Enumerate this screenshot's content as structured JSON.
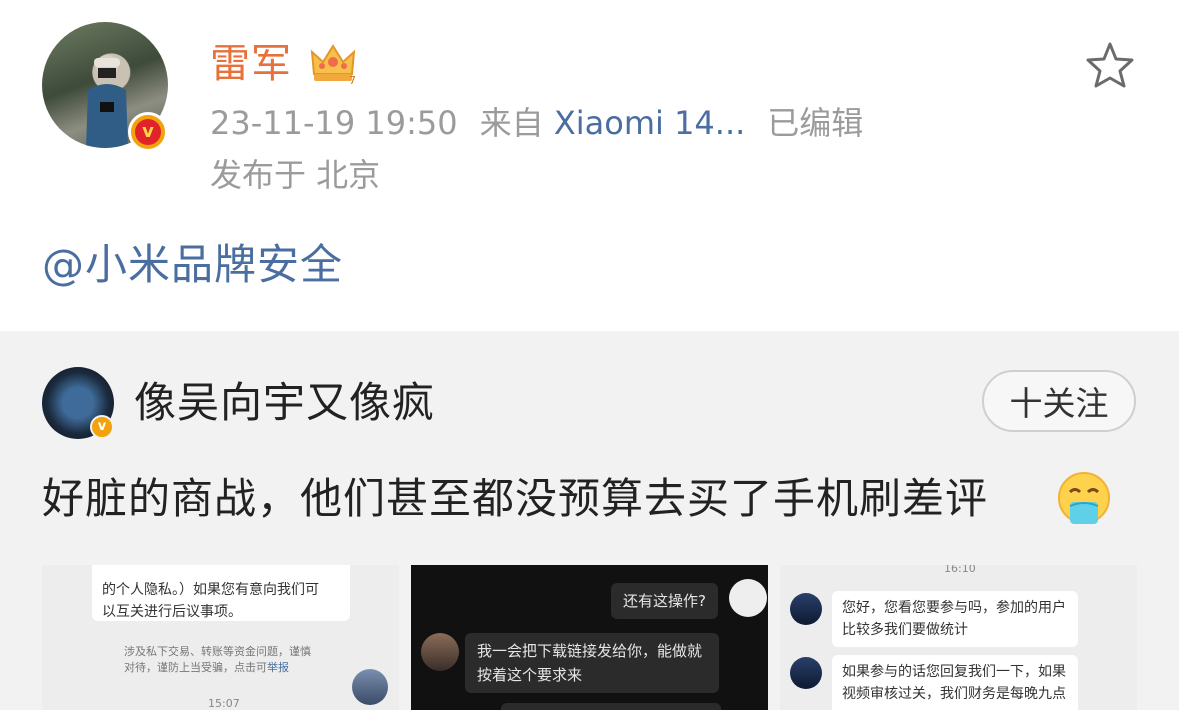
{
  "post": {
    "username": "雷军",
    "datetime": "23-11-19 19:50",
    "source_prefix": "来自",
    "device": "Xiaomi 14...",
    "edited": "已编辑",
    "location": "发布于 北京",
    "mention": "@小米品牌安全"
  },
  "repost": {
    "username": "像吴向宇又像疯",
    "follow_label": "十关注",
    "text": "好脏的商战，他们甚至都没预算去买了手机刷差评"
  },
  "thumbnails": {
    "t1": {
      "line1": "的个人隐私。）如果您有意向我们可",
      "line2": "以互关进行后议事项。",
      "notice1": "涉及私下交易、转账等资金问题，谨慎",
      "notice2_prefix": "对待，谨防上当受骗，点击可",
      "notice2_link": "举报",
      "time": "15:07"
    },
    "t2": {
      "msg1": "还有这操作?",
      "msg2_line1": "我一会把下载链接发给你，能做就",
      "msg2_line2": "按着这个要求来"
    },
    "t3": {
      "time": "16:10",
      "msg1_line1": "您好，您看您要参与吗，参加的用户",
      "msg1_line2": "比较多我们要做统计",
      "msg2_line1": "如果参与的话您回复我们一下，如果",
      "msg2_line2": "视频审核过关，我们财务是每晚九点"
    }
  },
  "colors": {
    "username": "#e8703a",
    "link": "#4a6ea0",
    "meta": "#9b9b9b",
    "repost_bg": "#f2f2f2",
    "verified_orange": "#f2a20c",
    "verified_red": "#e0242a"
  },
  "icons": [
    "crown-icon",
    "star-icon",
    "verified-badge-icon",
    "emoji-icon"
  ]
}
